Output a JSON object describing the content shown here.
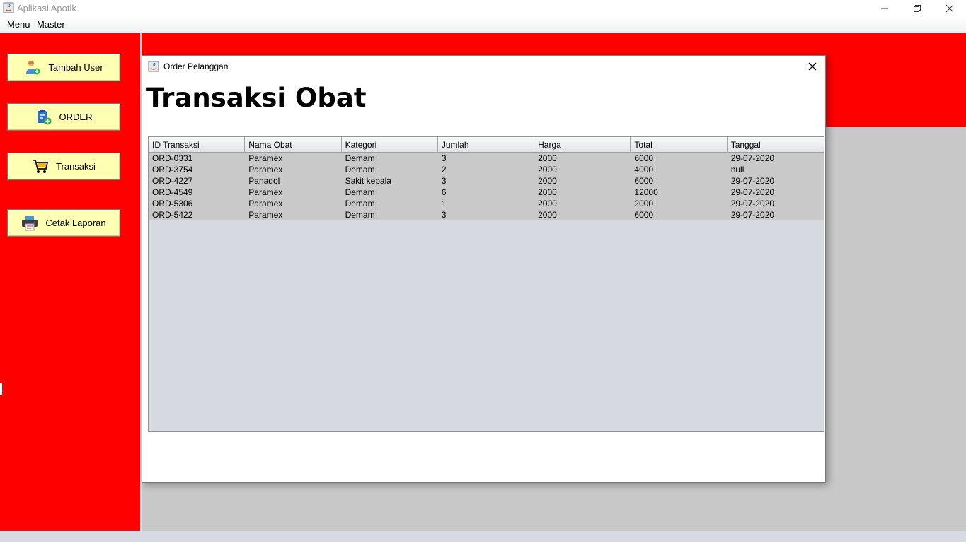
{
  "window": {
    "title": "Aplikasi Apotik"
  },
  "menubar": {
    "items": [
      {
        "label": "Menu"
      },
      {
        "label": "Master"
      }
    ]
  },
  "sidebar": {
    "buttons": [
      {
        "label": "Tambah User",
        "icon": "add-user-icon"
      },
      {
        "label": "ORDER",
        "icon": "clipboard-add-icon"
      },
      {
        "label": "Transaksi",
        "icon": "cart-icon"
      },
      {
        "label": "Cetak Laporan",
        "icon": "printer-icon"
      }
    ]
  },
  "dialog": {
    "title": "Order Pelanggan",
    "heading": "Transaksi Obat",
    "table": {
      "columns": [
        "ID Transaksi",
        "Nama Obat",
        "Kategori",
        "Jumlah",
        "Harga",
        "Total",
        "Tanggal"
      ],
      "rows": [
        [
          "ORD-0331",
          "Paramex",
          "Demam",
          "3",
          "2000",
          "6000",
          "29-07-2020"
        ],
        [
          "ORD-3754",
          "Paramex",
          "Demam",
          "2",
          "2000",
          "4000",
          "null"
        ],
        [
          "ORD-4227",
          "Panadol",
          "Sakit kepala",
          "3",
          "2000",
          "6000",
          "29-07-2020"
        ],
        [
          "ORD-4549",
          "Paramex",
          "Demam",
          "6",
          "2000",
          "12000",
          "29-07-2020"
        ],
        [
          "ORD-5306",
          "Paramex",
          "Demam",
          "1",
          "2000",
          "2000",
          "29-07-2020"
        ],
        [
          "ORD-5422",
          "Paramex",
          "Demam",
          "3",
          "2000",
          "6000",
          "29-07-2020"
        ]
      ]
    }
  },
  "colors": {
    "sidebar_bg": "#ff0000",
    "button_bg": "#ffffb4",
    "workspace_bg": "#c8c8c8",
    "table_bg": "#d6d9e0",
    "row_bg": "#c9c9c9"
  }
}
